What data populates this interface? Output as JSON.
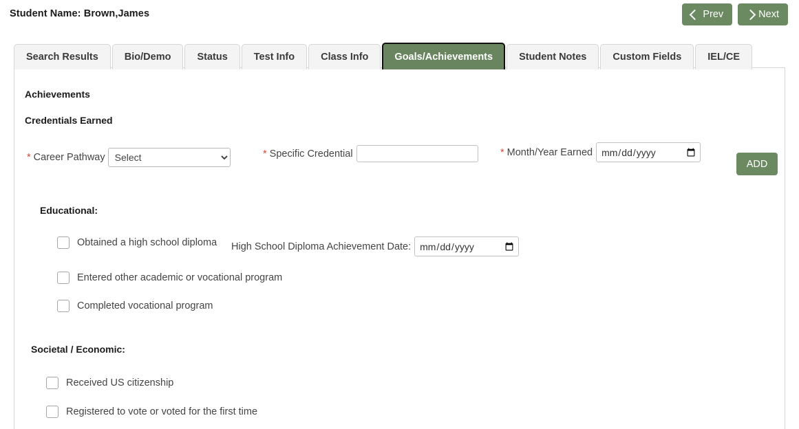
{
  "header": {
    "student_name_label": "Student Name: Brown,James",
    "prev_button": "Prev",
    "next_button": "Next"
  },
  "tabs": [
    {
      "label": "Search Results",
      "active": false
    },
    {
      "label": "Bio/Demo",
      "active": false
    },
    {
      "label": "Status",
      "active": false
    },
    {
      "label": "Test Info",
      "active": false
    },
    {
      "label": "Class Info",
      "active": false
    },
    {
      "label": "Goals/Achievements",
      "active": true
    },
    {
      "label": "Student Notes",
      "active": false
    },
    {
      "label": "Custom Fields",
      "active": false
    },
    {
      "label": "IEL/CE",
      "active": false
    }
  ],
  "content": {
    "achievements_heading": "Achievements",
    "credentials_heading": "Credentials Earned",
    "required_marker": "*",
    "career_pathway": {
      "label": "Career Pathway",
      "selected": "Select",
      "options": [
        "Select"
      ]
    },
    "specific_credential": {
      "label": "Specific Credential",
      "value": "",
      "placeholder": ""
    },
    "month_year_earned": {
      "label": "Month/Year Earned",
      "value": "",
      "placeholder": "mm/dd/yyyy"
    },
    "add_button": "ADD",
    "educational": {
      "title": "Educational:",
      "items": [
        {
          "label": "Obtained a high school diploma",
          "checked": false
        },
        {
          "label": "Entered other academic or vocational program",
          "checked": false
        },
        {
          "label": "Completed vocational program",
          "checked": false
        }
      ],
      "hs_diploma_date": {
        "label": "High School Diploma Achievement Date:",
        "value": "",
        "placeholder": "mm/dd/yyyy"
      }
    },
    "societal": {
      "title": "Societal / Economic:",
      "items": [
        {
          "label": "Received US citizenship",
          "checked": false
        },
        {
          "label": "Registered to vote or voted for the first time",
          "checked": false
        }
      ]
    }
  },
  "colors": {
    "accent_green": "#6b8a62",
    "active_tab_green": "#68855f",
    "required_red": "#d9483b"
  }
}
